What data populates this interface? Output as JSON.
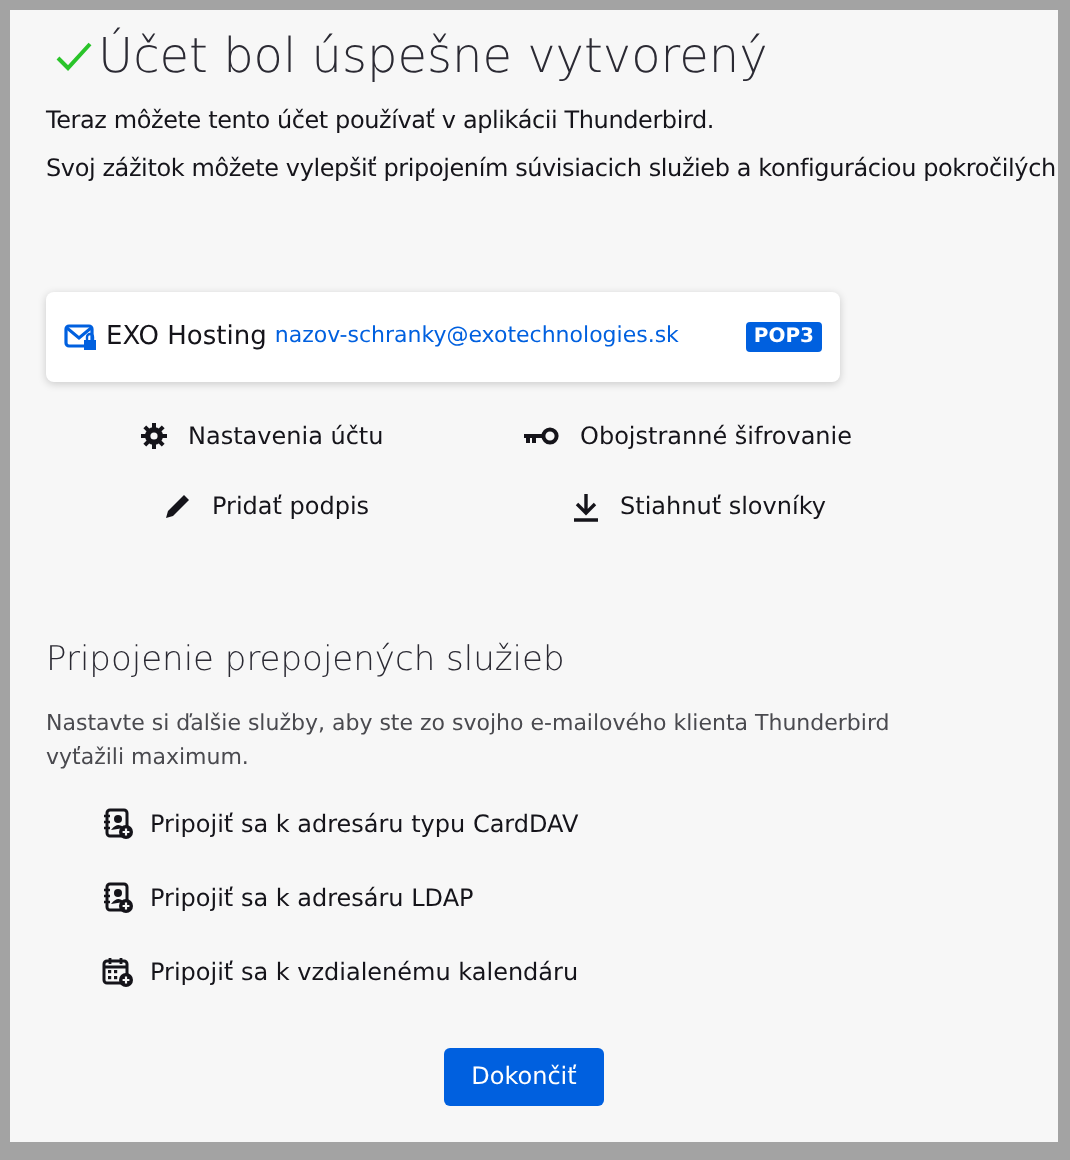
{
  "header": {
    "title": "Účet bol úspešne vytvorený"
  },
  "intro": [
    "Teraz môžete tento účet používať v aplikácii Thunderbird.",
    "Svoj zážitok môžete vylepšiť pripojením súvisiacich služieb a konfiguráciou pokročilých"
  ],
  "account": {
    "name": "EXO Hosting",
    "email": "nazov-schranky@exotechnologies.sk",
    "badge": "POP3"
  },
  "actions": [
    {
      "kind": "gear",
      "label": "Nastavenia účtu"
    },
    {
      "kind": "key",
      "label": "Obojstranné šifrovanie"
    },
    {
      "kind": "pencil",
      "label": "Pridať podpis"
    },
    {
      "kind": "download",
      "label": "Stiahnuť slovníky"
    }
  ],
  "services": {
    "title": "Pripojenie prepojených služieb",
    "description": "Nastavte si ďalšie služby, aby ste zo svojho e-mailového klienta Thunderbird vyťažili maximum.",
    "items": [
      {
        "kind": "addressbook",
        "label": "Pripojiť sa k adresáru typu CardDAV"
      },
      {
        "kind": "addressbook",
        "label": "Pripojiť sa k adresáru LDAP"
      },
      {
        "kind": "calendar",
        "label": "Pripojiť sa k vzdialenému kalendáru"
      }
    ]
  },
  "buttons": [
    "Dokončiť"
  ]
}
